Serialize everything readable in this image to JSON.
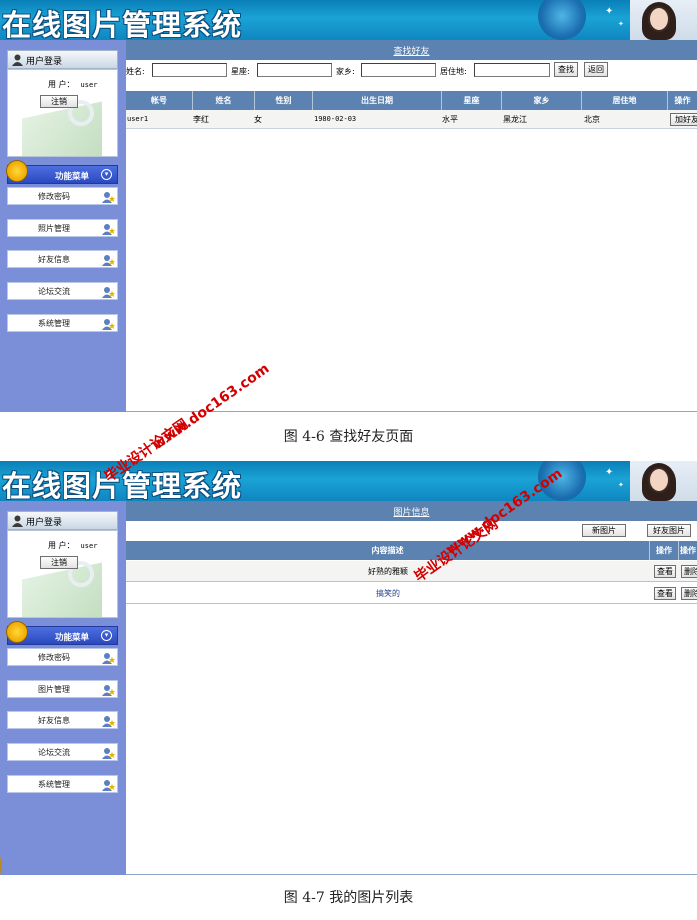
{
  "app_title": "在线图片管理系统",
  "sidebar": {
    "user_header": "用户登录",
    "user_label": "用 户：",
    "username": "user",
    "logout_label": "注销",
    "menu_header": "功能菜单",
    "menu_items": [
      "修改密码",
      "照片管理",
      "好友信息",
      "论坛交流",
      "系统管理"
    ],
    "menu_items_2": [
      "修改密码",
      "图片管理",
      "好友信息",
      "论坛交流",
      "系统管理"
    ]
  },
  "screen1": {
    "page_title": "查找好友",
    "search": {
      "name_label": "姓名:",
      "star_label": "星座:",
      "hometown_label": "家乡:",
      "residence_label": "居住地:",
      "find_button": "查找",
      "back_button": "返回"
    },
    "columns": [
      "帐号",
      "姓名",
      "性别",
      "出生日期",
      "星座",
      "家乡",
      "居住地",
      "操作"
    ],
    "rows": [
      {
        "account": "user1",
        "name": "李红",
        "gender": "女",
        "birthday": "1980-02-03",
        "star": "水平",
        "hometown": "黑龙江",
        "residence": "北京",
        "action": "加好友"
      }
    ]
  },
  "screen2": {
    "page_title": "图片信息",
    "new_picture_button": "新图片",
    "friend_pictures_button": "好友图片",
    "columns": [
      "内容描述",
      "操作",
      "操作"
    ],
    "rows": [
      {
        "description": "好熟的雅颖",
        "view": "查看",
        "delete": "删除"
      },
      {
        "description": "搞笑的",
        "view": "查看",
        "delete": "删除"
      }
    ]
  },
  "captions": {
    "fig1": "图 4-6   查找好友页面",
    "fig2": "图 4-7   我的图片列表"
  },
  "watermarks": {
    "site": "www.doc163.com",
    "name": "毕业设计论文网"
  },
  "colors": {
    "banner": "#0f8cc5",
    "sidebar": "#7b8fd9",
    "table_header": "#5b82b0",
    "watermark": "#d40000"
  }
}
